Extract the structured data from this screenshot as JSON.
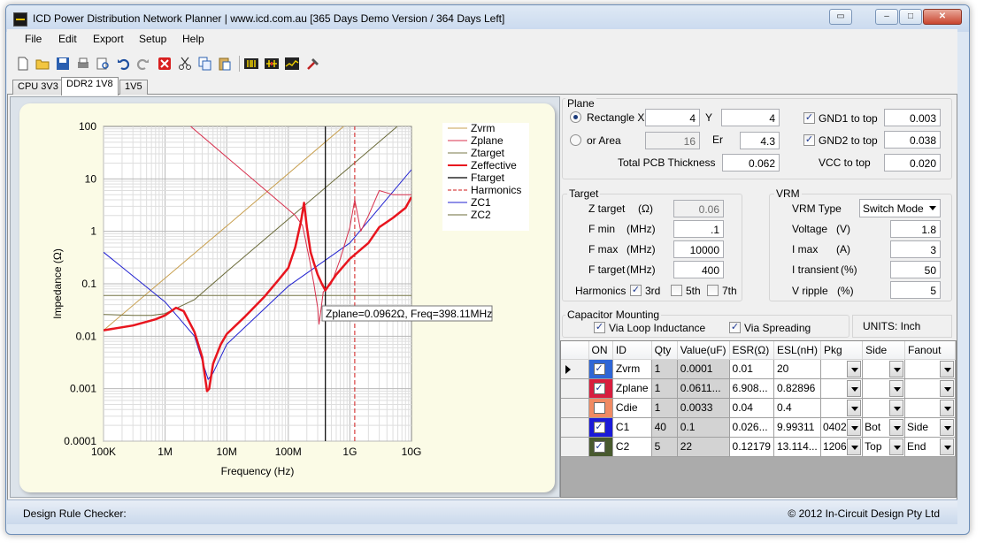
{
  "window": {
    "title": "ICD Power Distribution Network Planner | www.icd.com.au [365 Days Demo Version / 364 Days Left]"
  },
  "menu": [
    "File",
    "Edit",
    "Export",
    "Setup",
    "Help"
  ],
  "toolbar_icons": [
    "new-file-icon",
    "open-folder-icon",
    "save-icon",
    "print-icon",
    "print-preview-icon",
    "undo-icon",
    "redo-icon",
    "delete-icon",
    "cut-icon",
    "copy-icon",
    "paste-icon",
    "capacitor-add-icon",
    "capacitor-remove-icon",
    "chart-icon",
    "tools-icon"
  ],
  "tabs": [
    {
      "label": "CPU 3V3",
      "active": false
    },
    {
      "label": "DDR2 1V8",
      "active": true
    },
    {
      "label": "1V5",
      "active": false
    }
  ],
  "plane": {
    "title": "Plane",
    "rect_label": "Rectangle X",
    "rect_x": "4",
    "y_label": "Y",
    "y": "4",
    "area_label": "or Area",
    "area": "16",
    "er_label": "Er",
    "er": "4.3",
    "thickness_label": "Total PCB Thickness",
    "thickness": "0.062",
    "gnd1_label": "GND1 to top",
    "gnd1": "0.003",
    "gnd2_label": "GND2 to top",
    "gnd2": "0.038",
    "vcc_label": "VCC to top",
    "vcc": "0.020"
  },
  "target": {
    "title": "Target",
    "z_label": "Z target",
    "z_unit": "(Ω)",
    "z": "0.06",
    "fmin_label": "F min",
    "fmin_unit": "(MHz)",
    "fmin": ".1",
    "fmax_label": "F max",
    "fmax_unit": "(MHz)",
    "fmax": "10000",
    "ftarget_label": "F target",
    "ftarget_unit": "(MHz)",
    "ftarget": "400",
    "harmonics_label": "Harmonics",
    "h3": "3rd",
    "h5": "5th",
    "h7": "7th"
  },
  "vrm": {
    "title": "VRM",
    "type_label": "VRM Type",
    "type": "Switch Mode",
    "voltage_label": "Voltage",
    "voltage_unit": "(V)",
    "voltage": "1.8",
    "imax_label": "I max",
    "imax_unit": "(A)",
    "imax": "3",
    "itrans_label": "I transient",
    "itrans_unit": "(%)",
    "itrans": "50",
    "vripple_label": "V ripple",
    "vripple_unit": "(%)",
    "vripple": "5"
  },
  "mounting": {
    "title": "Capacitor Mounting",
    "loop": "Via Loop Inductance",
    "spreading": "Via Spreading",
    "units": "UNITS: Inch"
  },
  "cap_table": {
    "headers": [
      "ON",
      "ID",
      "Qty",
      "Value(uF)",
      "ESR(Ω)",
      "ESL(nH)",
      "Pkg",
      "Side",
      "Fanout"
    ],
    "rows": [
      {
        "color": "#2f66d6",
        "on": true,
        "id": "Zvrm",
        "qty": "1",
        "value": "0.0001",
        "esr": "0.01",
        "esl": "20",
        "pkg": "",
        "side": "",
        "fanout": "",
        "current": true
      },
      {
        "color": "#d81d3e",
        "on": true,
        "id": "Zplane",
        "qty": "1",
        "value": "0.0611...",
        "esr": "6.908...",
        "esl": "0.82896",
        "pkg": "",
        "side": "",
        "fanout": ""
      },
      {
        "color": "#f08a63",
        "on": false,
        "id": "Cdie",
        "qty": "1",
        "value": "0.0033",
        "esr": "0.04",
        "esl": "0.4",
        "pkg": "",
        "side": "",
        "fanout": ""
      },
      {
        "color": "#1a1ad8",
        "on": true,
        "id": "C1",
        "qty": "40",
        "value": "0.1",
        "esr": "0.026...",
        "esl": "9.99311",
        "pkg": "0402",
        "side": "Bot",
        "fanout": "Side"
      },
      {
        "color": "#485a2e",
        "on": true,
        "id": "C2",
        "qty": "5",
        "value": "22",
        "esr": "0.12179",
        "esl": "13.114...",
        "pkg": "1206",
        "side": "Top",
        "fanout": "End"
      }
    ]
  },
  "status": {
    "left": "Design Rule Checker:",
    "right": "© 2012 In-Circuit Design Pty Ltd"
  },
  "chart_data": {
    "type": "line",
    "xlabel": "Frequency (Hz)",
    "ylabel": "Impedance (Ω)",
    "x_scale": "log",
    "y_scale": "log",
    "xlim": [
      100000,
      10000000000
    ],
    "ylim": [
      0.0001,
      100
    ],
    "xticks": [
      {
        "v": 100000,
        "label": "100K"
      },
      {
        "v": 1000000,
        "label": "1M"
      },
      {
        "v": 10000000,
        "label": "10M"
      },
      {
        "v": 100000000,
        "label": "100M"
      },
      {
        "v": 1000000000,
        "label": "1G"
      },
      {
        "v": 10000000000,
        "label": "10G"
      }
    ],
    "yticks": [
      {
        "v": 100,
        "label": "100"
      },
      {
        "v": 10,
        "label": "10"
      },
      {
        "v": 1,
        "label": "1"
      },
      {
        "v": 0.1,
        "label": "0.1"
      },
      {
        "v": 0.01,
        "label": "0.01"
      },
      {
        "v": 0.001,
        "label": "0.001"
      },
      {
        "v": 0.0001,
        "label": "0.0001"
      }
    ],
    "grid": true,
    "legend_position": "top-right",
    "series": [
      {
        "name": "Zvrm",
        "color": "#c8a050",
        "width": 1,
        "x": [
          100000,
          10000000,
          1000000000,
          10000000000
        ],
        "y": [
          0.013,
          1.26,
          126,
          1260
        ]
      },
      {
        "name": "Zplane",
        "color": "#d8314e",
        "width": 1,
        "x": [
          100000,
          1000000,
          10000000,
          100000000,
          130000000,
          170000000,
          190000000,
          200000000,
          220000000,
          260000000,
          300000000,
          315000000,
          330000000,
          370000000,
          500000000,
          700000000,
          1000000000,
          1200000000,
          1500000000,
          2000000000,
          3000000000,
          5000000000,
          10000000000
        ],
        "y": [
          5000,
          260,
          26,
          2.6,
          2,
          1.3,
          0.7,
          0.5,
          0.3,
          0.1,
          0.035,
          0.017,
          0.025,
          0.07,
          0.1,
          0.3,
          1.2,
          4,
          1,
          2,
          6,
          5,
          5
        ]
      },
      {
        "name": "Ztarget",
        "color": "#7a7a4a",
        "width": 1,
        "x": [
          100000,
          10000000000
        ],
        "y": [
          0.06,
          0.06
        ]
      },
      {
        "name": "Zeffective",
        "color": "#e8151e",
        "width": 2.5,
        "x": [
          100000,
          300000,
          700000,
          1000000,
          1500000,
          2000000,
          3000000,
          4000000,
          4800000,
          5200000,
          6000000,
          8000000,
          10000000,
          20000000,
          40000000,
          70000000,
          100000000,
          130000000,
          160000000,
          180000000,
          200000000,
          230000000,
          260000000,
          300000000,
          350000000,
          400000000,
          600000000,
          1000000000,
          2000000000,
          3000000000,
          5000000000,
          8000000000,
          10000000000
        ],
        "y": [
          0.013,
          0.016,
          0.021,
          0.025,
          0.035,
          0.03,
          0.012,
          0.004,
          0.0009,
          0.001,
          0.003,
          0.007,
          0.011,
          0.024,
          0.055,
          0.12,
          0.2,
          0.5,
          1.5,
          3.5,
          1.2,
          0.4,
          0.25,
          0.15,
          0.1,
          0.075,
          0.15,
          0.3,
          0.6,
          1.2,
          1.8,
          2.8,
          4.5
        ]
      },
      {
        "name": "Ftarget",
        "color": "#000000",
        "width": 1.2,
        "x": [
          400000000,
          400000000
        ],
        "y": [
          0.0001,
          100
        ]
      },
      {
        "name": "Harmonics",
        "color": "#d11a1a",
        "width": 1,
        "dash": true,
        "x": [
          1200000000,
          1200000000
        ],
        "y": [
          0.0001,
          100
        ]
      },
      {
        "name": "ZC1",
        "color": "#2020d0",
        "width": 1,
        "x": [
          100000,
          1000000,
          3000000,
          5000000,
          6000000,
          10000000,
          100000000,
          1000000000,
          10000000000
        ],
        "y": [
          0.4,
          0.045,
          0.01,
          0.0015,
          0.002,
          0.007,
          0.09,
          0.6,
          15
        ]
      },
      {
        "name": "ZC2",
        "color": "#6b6b3a",
        "width": 1,
        "x": [
          100000,
          300000,
          600000,
          1000000,
          3000000,
          10000000,
          100000000,
          1000000000,
          10000000000
        ],
        "y": [
          0.026,
          0.025,
          0.025,
          0.027,
          0.05,
          0.17,
          1.7,
          17,
          170
        ]
      }
    ],
    "tooltip": "Zplane=0.0962Ω, Freq=398.11MHz"
  }
}
